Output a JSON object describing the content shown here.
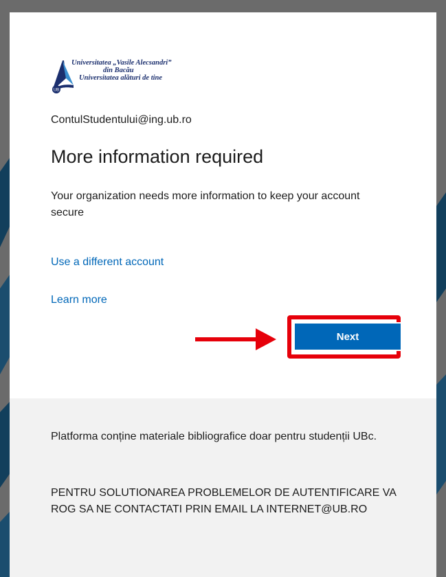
{
  "logo": {
    "line1": "Universitatea „Vasile Alecsandri”",
    "line2": "din Bacău",
    "line3": "Universitatea alături de tine",
    "badge": "UB"
  },
  "account": {
    "email": "ContulStudentului@ing.ub.ro"
  },
  "main": {
    "title": "More information required",
    "description": "Your organization needs more information to keep your account secure",
    "use_different_account": "Use a different account",
    "learn_more": "Learn more",
    "next_label": "Next"
  },
  "footer": {
    "note": "Platforma conține materiale bibliografice doar pentru studenții UBc.",
    "support": "PENTRU SOLUTIONAREA PROBLEMELOR DE AUTENTIFICARE VA ROG SA NE CONTACTATI PRIN EMAIL LA INTERNET@UB.RO"
  },
  "colors": {
    "accent": "#0067b8",
    "annotation": "#e6000a",
    "footer_bg": "#f2f2f2",
    "backdrop": "#6b6b6b",
    "logo_blue": "#1b2f6e"
  },
  "icons": {
    "logo": "university-logo-icon",
    "annotation_arrow": "arrow-right-icon"
  }
}
